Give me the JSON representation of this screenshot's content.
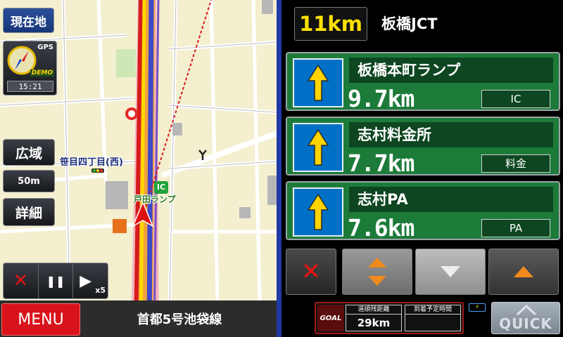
{
  "map": {
    "current_location_label": "現在地",
    "wide_label": "広域",
    "scale_label": "50m",
    "detail_label": "詳細",
    "gps_label": "GPS",
    "demo_label": "DEMO",
    "clock": "15:21",
    "intersection_label": "笹目四丁目(西)",
    "ramp_label": "戸田ランプ",
    "ic_badge": "IC",
    "simulation": {
      "stop_icon": "✕",
      "pause_icon": "❚❚",
      "play_icon": "▶",
      "speed": "x5"
    },
    "menu_label": "MENU",
    "road_name": "首都5号池袋線"
  },
  "guidance": {
    "next_distance": "11km",
    "next_name": "板橋JCT",
    "facilities": [
      {
        "name": "板橋本町ランプ",
        "distance": "9.7km",
        "type": "IC"
      },
      {
        "name": "志村料金所",
        "distance": "7.7km",
        "type": "料金"
      },
      {
        "name": "志村PA",
        "distance": "7.6km",
        "type": "PA"
      }
    ],
    "close_icon": "✕",
    "goal": {
      "goal_label": "GOAL",
      "remaining_title": "道順残距離",
      "remaining_value": "29km",
      "eta_title": "到着予定時間",
      "eta_value": ""
    },
    "quick_label": "QUICK"
  },
  "colors": {
    "panel_green": "#1d7b3a",
    "arrow_blue": "#0070c6",
    "menu_red": "#d8131b",
    "distance_yellow": "#ffe100",
    "route_orange": "#f1a33b"
  }
}
